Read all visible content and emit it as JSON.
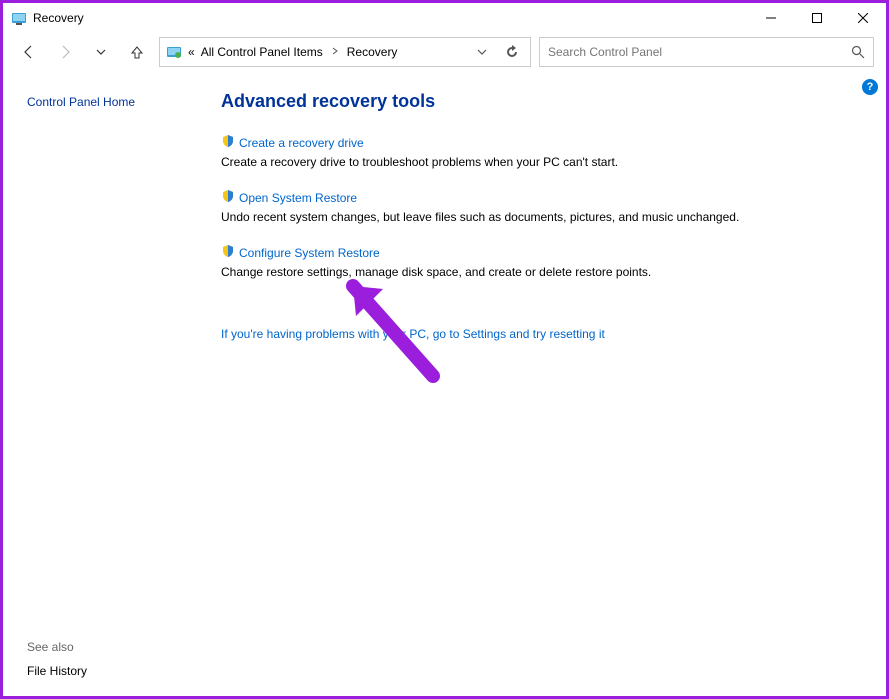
{
  "window": {
    "title": "Recovery"
  },
  "breadcrumb": {
    "prefix": "«",
    "seg1": "All Control Panel Items",
    "seg2": "Recovery"
  },
  "search": {
    "placeholder": "Search Control Panel"
  },
  "sidebar": {
    "home": "Control Panel Home",
    "seealso_label": "See also",
    "filehistory": "File History"
  },
  "main": {
    "heading": "Advanced recovery tools",
    "tools": [
      {
        "link": "Create a recovery drive",
        "desc": "Create a recovery drive to troubleshoot problems when your PC can't start."
      },
      {
        "link": "Open System Restore",
        "desc": "Undo recent system changes, but leave files such as documents, pictures, and music unchanged."
      },
      {
        "link": "Configure System Restore",
        "desc": "Change restore settings, manage disk space, and create or delete restore points."
      }
    ],
    "extra_link": "If you're having problems with your PC, go to Settings and try resetting it"
  },
  "help": {
    "badge": "?"
  }
}
